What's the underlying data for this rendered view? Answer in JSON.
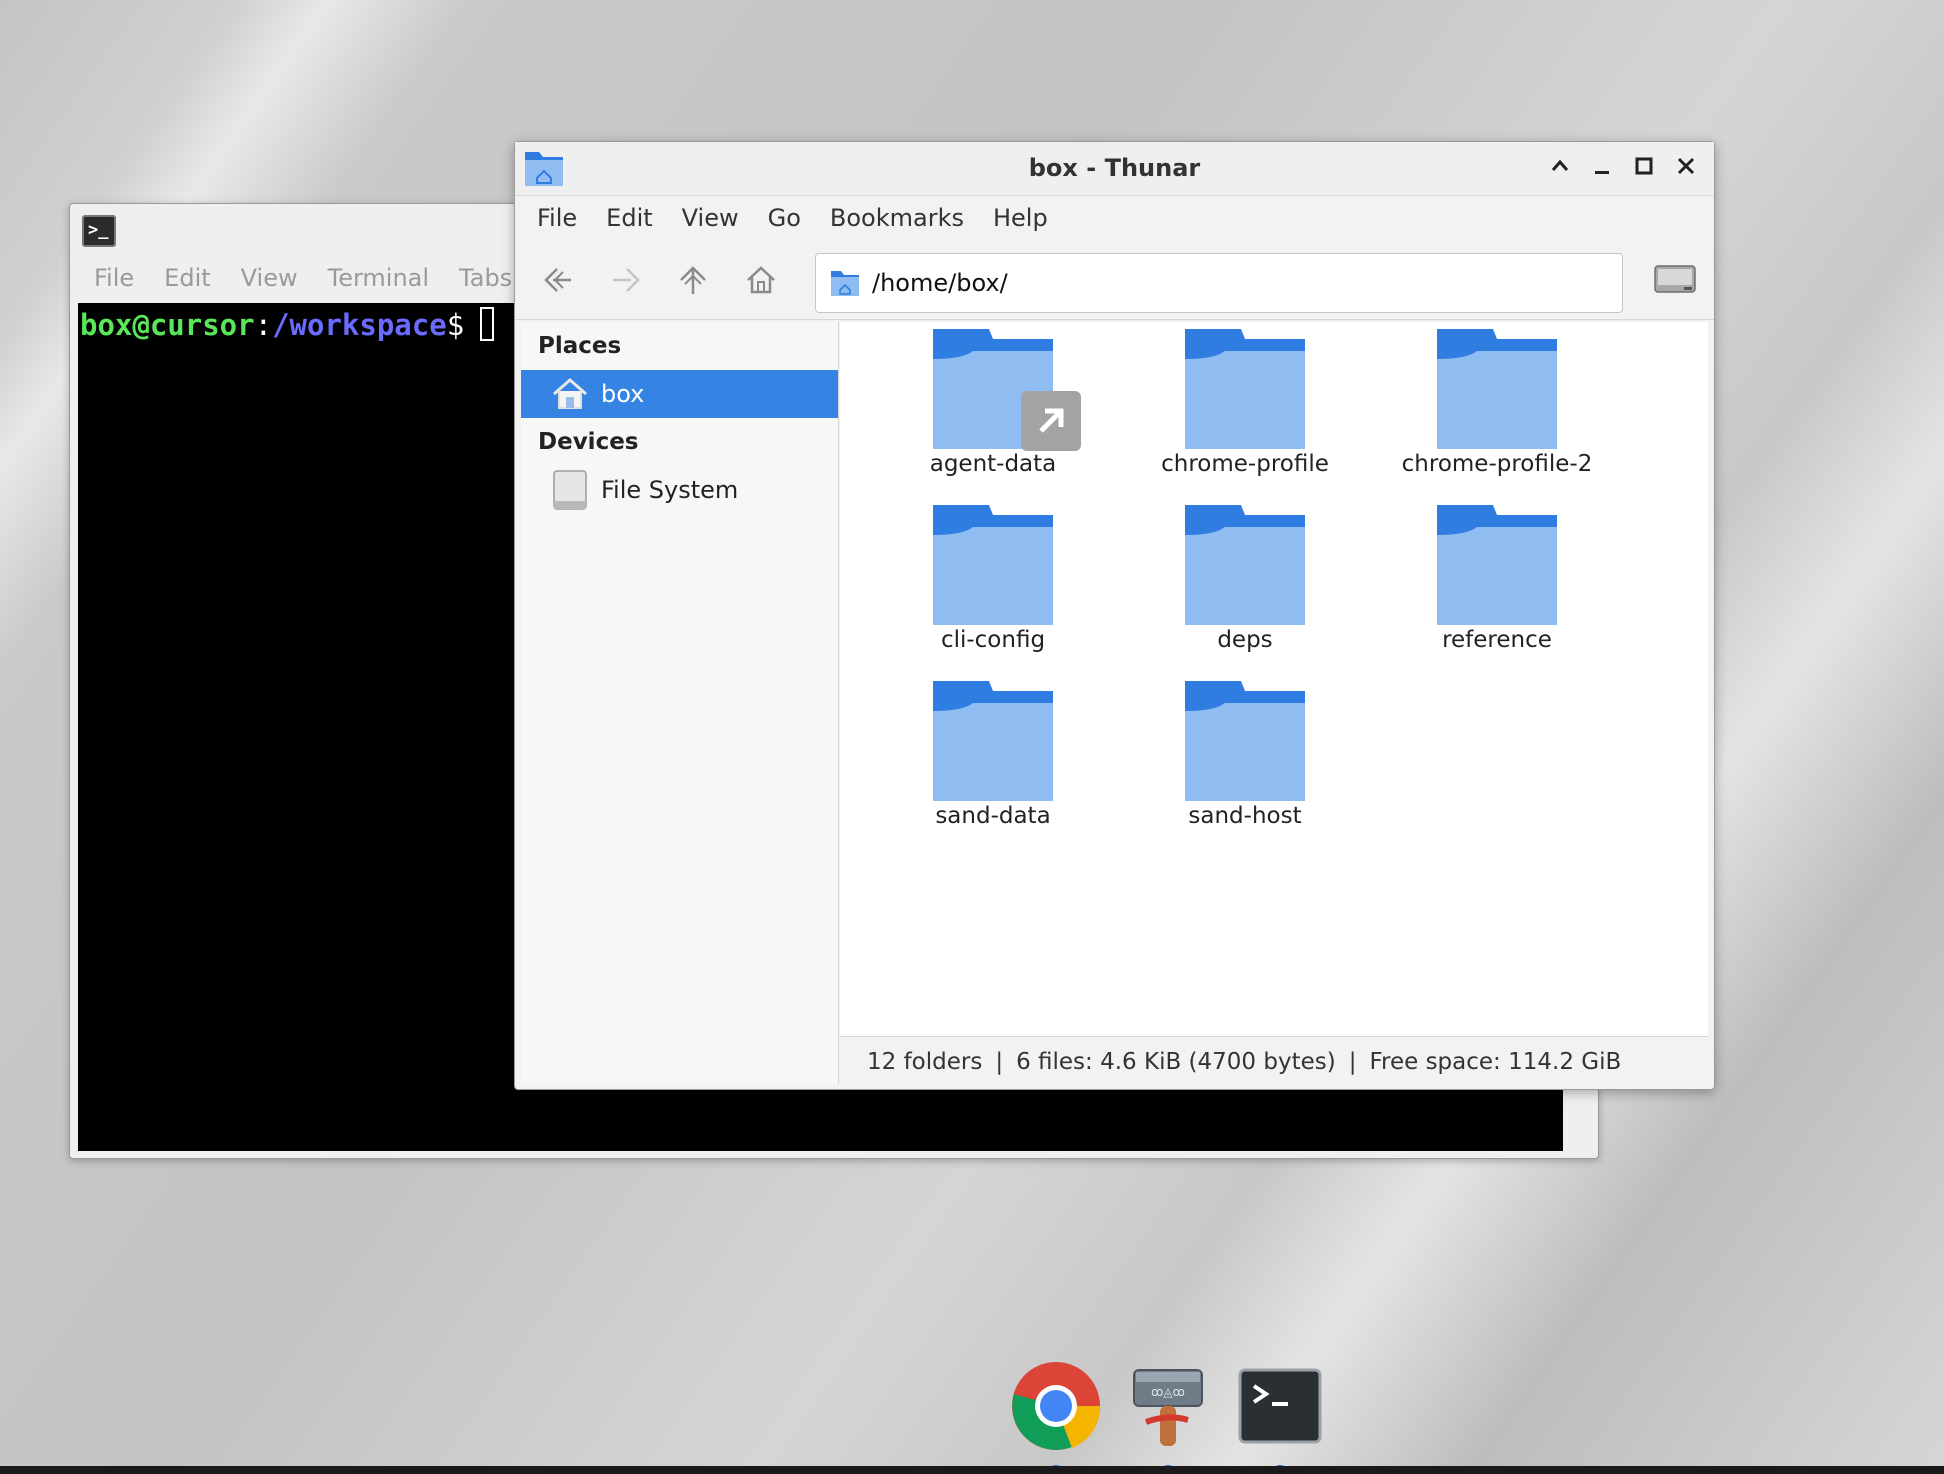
{
  "terminal": {
    "icon": "terminal-icon",
    "menu": [
      "File",
      "Edit",
      "View",
      "Terminal",
      "Tabs"
    ],
    "prompt_user": "box@cursor",
    "prompt_colon": ":",
    "prompt_path": "/workspace",
    "prompt_dollar": "$"
  },
  "thunar": {
    "title": "box - Thunar",
    "icon": "home-folder-icon",
    "window_controls": [
      "chevron-up-icon",
      "minimize-icon",
      "maximize-icon",
      "close-icon"
    ],
    "menu": [
      "File",
      "Edit",
      "View",
      "Go",
      "Bookmarks",
      "Help"
    ],
    "toolbar_icons": [
      "back-icon",
      "forward-icon",
      "up-icon",
      "home-icon"
    ],
    "location": "/home/box/",
    "sidebar": {
      "places_heading": "Places",
      "places": [
        {
          "label": "box",
          "icon": "home-icon",
          "selected": true
        }
      ],
      "devices_heading": "Devices",
      "devices": [
        {
          "label": "File System",
          "icon": "drive-icon"
        }
      ]
    },
    "files": [
      {
        "name": "agent-data",
        "symlink": true
      },
      {
        "name": "chrome-profile",
        "symlink": false
      },
      {
        "name": "chrome-profile-2",
        "symlink": false
      },
      {
        "name": "cli-config",
        "symlink": false
      },
      {
        "name": "deps",
        "symlink": false
      },
      {
        "name": "reference",
        "symlink": false
      },
      {
        "name": "sand-data",
        "symlink": false
      },
      {
        "name": "sand-host",
        "symlink": false
      }
    ],
    "status": {
      "folders": "12 folders",
      "files": "6 files: 4.6 KiB (4700 bytes)",
      "free": "Free space: 114.2 GiB",
      "separator": "|"
    }
  },
  "dock": [
    "chrome-icon",
    "file-manager-icon",
    "terminal-icon"
  ],
  "colors": {
    "accent": "#3584e4",
    "folder_light": "#8fbdf2",
    "folder_dark": "#2f7de0",
    "prompt_user": "#59e659",
    "prompt_path": "#6b6bff"
  }
}
